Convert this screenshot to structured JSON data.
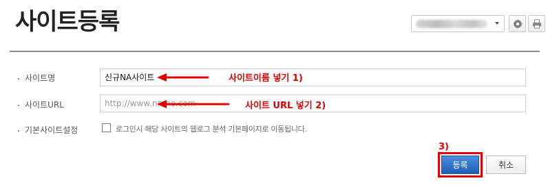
{
  "page": {
    "title": "사이트등록"
  },
  "header_tools": {
    "site_selector_value": "",
    "gear_icon": "gear-icon",
    "print_icon": "print-icon"
  },
  "form": {
    "site_name_label": "사이트명",
    "site_name_value": "신규NA사이트",
    "site_url_label": "사이트URL",
    "site_url_value": "http://www.nmno.com",
    "default_site_label": "기본사이트설정",
    "default_site_checkbox_text": "로그인시 해당 사이트의 웹로그 분석 기본페이지로 이동됩니다.",
    "default_site_checked": false
  },
  "buttons": {
    "register_label": "등록",
    "cancel_label": "취소"
  },
  "annotations": {
    "step1": "사이트이름 넣기 1)",
    "step2": "사이트 URL 넣기 2)",
    "step3": "3)",
    "color": "#e00000"
  },
  "colors": {
    "primary_button": "#2a6cc8",
    "annotation": "#e00000",
    "divider": "#8a8a8a"
  }
}
